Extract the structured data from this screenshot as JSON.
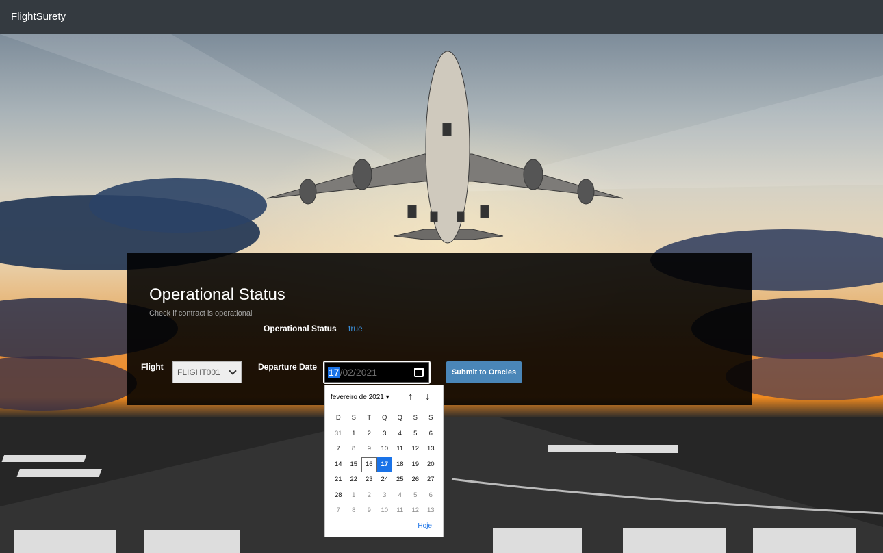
{
  "navbar": {
    "brand": "FlightSurety"
  },
  "panel": {
    "title": "Operational Status",
    "subtitle": "Check if contract is operational",
    "status_label": "Operational Status",
    "status_value": "true"
  },
  "form": {
    "flight_label": "Flight",
    "flight_selected": "FLIGHT001",
    "date_label": "Departure Date",
    "date_day": "17",
    "date_rest": "/02/2021",
    "submit_label": "Submit to Oracles"
  },
  "datepicker": {
    "month_label": "fevereiro de 2021 ▾",
    "up_arrow": "↑",
    "down_arrow": "↓",
    "weekdays": [
      "D",
      "S",
      "T",
      "Q",
      "Q",
      "S",
      "S"
    ],
    "days": [
      [
        "31",
        "1",
        "2",
        "3",
        "4",
        "5",
        "6"
      ],
      [
        "7",
        "8",
        "9",
        "10",
        "11",
        "12",
        "13"
      ],
      [
        "14",
        "15",
        "16",
        "17",
        "18",
        "19",
        "20"
      ],
      [
        "21",
        "22",
        "23",
        "24",
        "25",
        "26",
        "27"
      ],
      [
        "28",
        "1",
        "2",
        "3",
        "4",
        "5",
        "6"
      ],
      [
        "7",
        "8",
        "9",
        "10",
        "11",
        "12",
        "13"
      ]
    ],
    "today_label": "Hoje",
    "selected_day": "17",
    "today_day": "16"
  },
  "colors": {
    "accent": "#1a73e8",
    "navbar": "#343a40",
    "button": "#4a86b8",
    "status_value": "#3b8fd9"
  }
}
